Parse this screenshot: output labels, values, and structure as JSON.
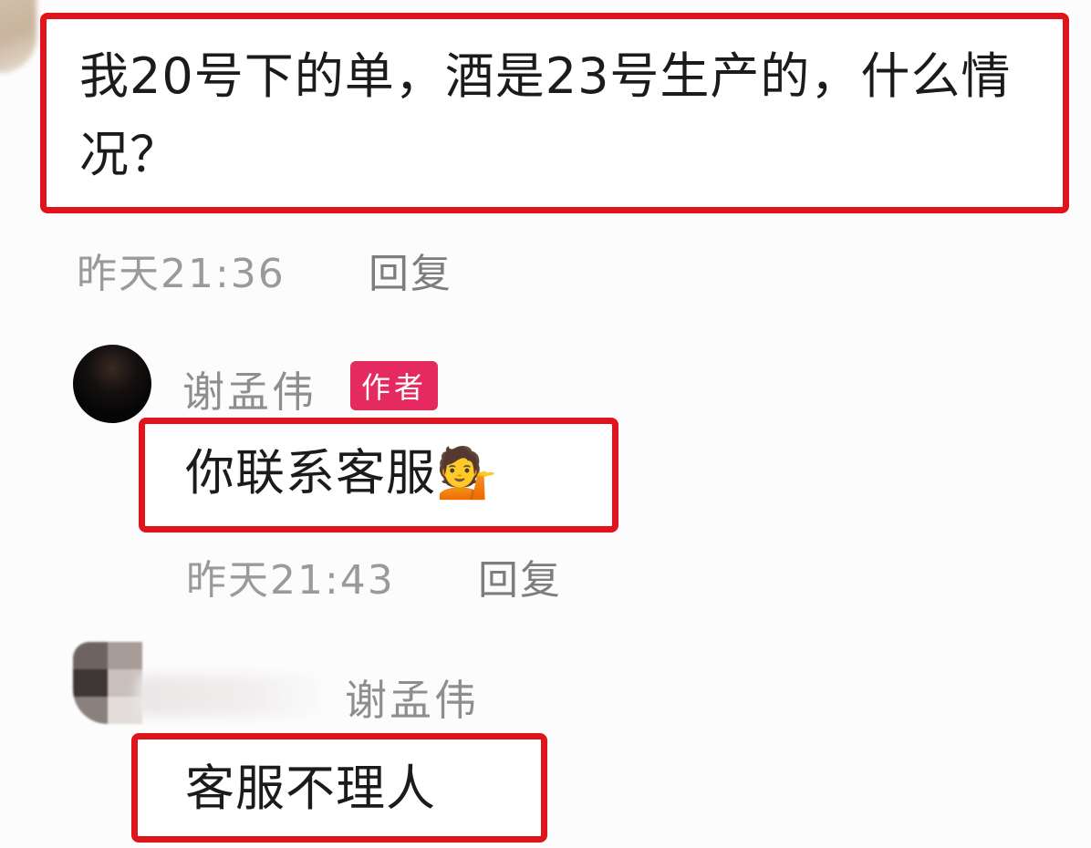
{
  "comments": [
    {
      "text": "我20号下的单，酒是23号生产的，什么情况？",
      "time": "昨天21:36",
      "reply_label": "回复"
    },
    {
      "username": "谢孟伟",
      "badge": "作者",
      "text": "你联系客服",
      "emoji": "💁",
      "emoji_icon": "person-tipping-hand-icon",
      "time": "昨天21:43",
      "reply_label": "回复"
    },
    {
      "reply_to": "谢孟伟",
      "text": "客服不理人"
    }
  ],
  "colors": {
    "highlight_border": "#e0141d",
    "author_badge": "#e42a5f",
    "meta_text": "#9a9a9a",
    "body_text": "#1b1b1b"
  }
}
